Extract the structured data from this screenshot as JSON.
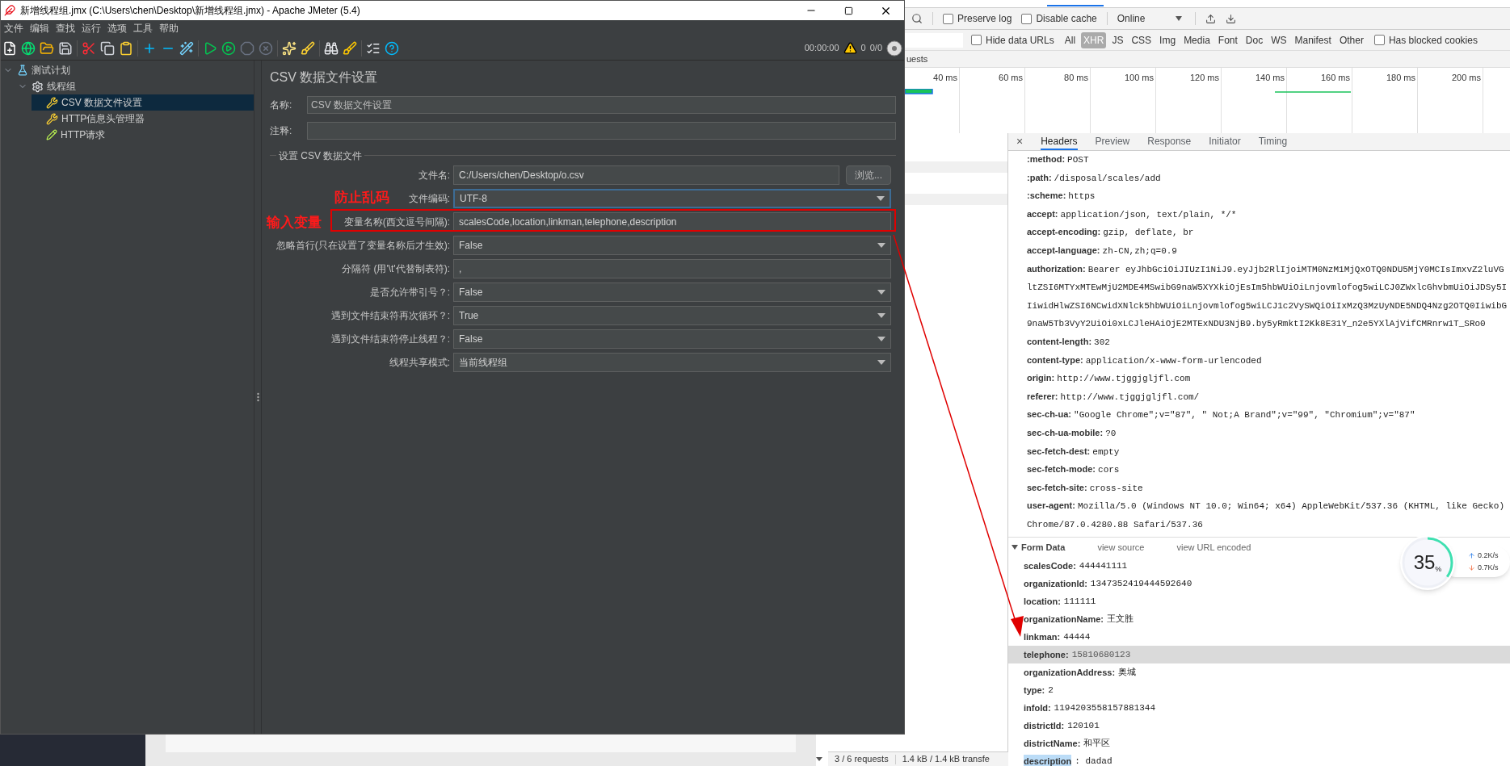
{
  "jmeter": {
    "window_title": "新增线程组.jmx (C:\\Users\\chen\\Desktop\\新增线程组.jmx) - Apache JMeter (5.4)",
    "menu": [
      "文件",
      "编辑",
      "查找",
      "运行",
      "选项",
      "工具",
      "帮助"
    ],
    "toolbar_status": {
      "timer": "00:00:00",
      "warnings": "0",
      "threads": "0/0"
    },
    "tree": [
      {
        "label": "测试计划",
        "kind": "plan",
        "selected": false,
        "expanded": true,
        "children": [
          {
            "label": "线程组",
            "kind": "group",
            "selected": false,
            "expanded": true,
            "children": [
              {
                "label": "CSV 数据文件设置",
                "kind": "config",
                "selected": true
              },
              {
                "label": "HTTP信息头管理器",
                "kind": "config",
                "selected": false
              },
              {
                "label": "HTTP请求",
                "kind": "sampler",
                "selected": false
              }
            ]
          }
        ]
      }
    ],
    "panel": {
      "title": "CSV 数据文件设置",
      "name_label": "名称:",
      "name_value": "CSV 数据文件设置",
      "comment_label": "注释:",
      "fieldset": "设置 CSV 数据文件",
      "rows": [
        {
          "kind": "file",
          "label": "文件名:",
          "value": "C:/Users/chen/Desktop/o.csv",
          "button": "浏览..."
        },
        {
          "kind": "select",
          "label": "文件编码:",
          "value": "UTF-8",
          "focused": true
        },
        {
          "kind": "text",
          "label": "变量名称(西文逗号间隔):",
          "value": "scalesCode,location,linkman,telephone,description"
        },
        {
          "kind": "select",
          "label": "忽略首行(只在设置了变量名称后才生效):",
          "value": "False",
          "focused": false
        },
        {
          "kind": "text",
          "label": "分隔符 (用'\\t'代替制表符):",
          "value": ","
        },
        {
          "kind": "select",
          "label": "是否允许带引号？:",
          "value": "False",
          "focused": false
        },
        {
          "kind": "select",
          "label": "遇到文件结束符再次循环？:",
          "value": "True",
          "focused": false
        },
        {
          "kind": "select",
          "label": "遇到文件结束符停止线程？:",
          "value": "False",
          "focused": false
        },
        {
          "kind": "select",
          "label": "线程共享模式:",
          "value": "当前线程组",
          "focused": false
        }
      ]
    }
  },
  "annotations": [
    {
      "kind": "note",
      "text": "防止乱码"
    },
    {
      "kind": "note",
      "text": "输入变量"
    },
    {
      "kind": "box"
    },
    {
      "kind": "arrow"
    }
  ],
  "devtools": {
    "toolbar": {
      "preserve_log": {
        "label": "Preserve log",
        "checked": false
      },
      "disable_cache": {
        "label": "Disable cache",
        "checked": false
      },
      "throttle": "Online"
    },
    "filters": {
      "hide_data_urls": {
        "label": "Hide data URLs",
        "checked": false
      },
      "types": [
        {
          "label": "All",
          "selected": false
        },
        {
          "label": "XHR",
          "selected": true
        },
        {
          "label": "JS",
          "selected": false
        },
        {
          "label": "CSS",
          "selected": false
        },
        {
          "label": "Img",
          "selected": false
        },
        {
          "label": "Media",
          "selected": false
        },
        {
          "label": "Font",
          "selected": false
        },
        {
          "label": "Doc",
          "selected": false
        },
        {
          "label": "WS",
          "selected": false
        },
        {
          "label": "Manifest",
          "selected": false
        },
        {
          "label": "Other",
          "selected": false
        }
      ],
      "blocked_cookies": {
        "label": "Has blocked cookies",
        "checked": false
      }
    },
    "requests_label": "uests",
    "timeline_ticks": [
      "40 ms",
      "60 ms",
      "80 ms",
      "100 ms",
      "120 ms",
      "140 ms",
      "160 ms",
      "180 ms",
      "200 ms"
    ],
    "detail_tabs": [
      {
        "label": "Headers",
        "selected": true
      },
      {
        "label": "Preview",
        "selected": false
      },
      {
        "label": "Response",
        "selected": false
      },
      {
        "label": "Initiator",
        "selected": false
      },
      {
        "label": "Timing",
        "selected": false
      }
    ],
    "close_glyph": "×",
    "headers": [
      {
        "name": ":method:",
        "value": "POST"
      },
      {
        "name": ":path:",
        "value": "/disposal/scales/add"
      },
      {
        "name": ":scheme:",
        "value": "https"
      },
      {
        "name": "accept:",
        "value": "application/json, text/plain, */*"
      },
      {
        "name": "accept-encoding:",
        "value": "gzip, deflate, br"
      },
      {
        "name": "accept-language:",
        "value": "zh-CN,zh;q=0.9"
      },
      {
        "name": "authorization:",
        "value": "Bearer eyJhbGciOiJIUzI1NiJ9.eyJjb2RlIjoiMTM0NzM1MjQxOTQ0NDU5MjY0MCIsImxvZ2luVGltZSI6MTYxMTEwMjU2MDE4MSwibG9naW5XYXkiOjEsIm5hbWUiOiLnjovmlofog5wiLCJ0ZWxlcGhvbmUiOiJDSy5IIiwidHlwZSI6NCwidXNlck5hbWUiOiLnjovmlofog5wiLCJ1c2VySWQiOiIxMzQ3MzUyNDE5NDQ4Nzg2OTQ0IiwibG9naW5Tb3VyY2UiOi0xLCJleHAiOjE2MTExNDU3NjB9.by5yRmktI2Kk8E31Y_n2e5YXlAjVifCMRnrw1T_SRo0"
      },
      {
        "name": "content-length:",
        "value": "302"
      },
      {
        "name": "content-type:",
        "value": "application/x-www-form-urlencoded"
      },
      {
        "name": "origin:",
        "value": "http://www.tjggjgljfl.com"
      },
      {
        "name": "referer:",
        "value": "http://www.tjggjgljfl.com/"
      },
      {
        "name": "sec-ch-ua:",
        "value": "\"Google Chrome\";v=\"87\", \" Not;A Brand\";v=\"99\", \"Chromium\";v=\"87\""
      },
      {
        "name": "sec-ch-ua-mobile:",
        "value": "?0"
      },
      {
        "name": "sec-fetch-dest:",
        "value": "empty"
      },
      {
        "name": "sec-fetch-mode:",
        "value": "cors"
      },
      {
        "name": "sec-fetch-site:",
        "value": "cross-site"
      },
      {
        "name": "user-agent:",
        "value": "Mozilla/5.0 (Windows NT 10.0; Win64; x64) AppleWebKit/537.36 (KHTML, like Gecko) Chrome/87.0.4280.88 Safari/537.36"
      }
    ],
    "form_data": {
      "title": "Form Data",
      "expanded": true,
      "links": [
        "view source",
        "view URL encoded"
      ],
      "fields": [
        {
          "name": "scalesCode:",
          "value": "444441111",
          "selected": false,
          "name_highlighted": false
        },
        {
          "name": "organizationId:",
          "value": "1347352419444592640",
          "selected": false,
          "name_highlighted": false
        },
        {
          "name": "location:",
          "value": "111111",
          "selected": false,
          "name_highlighted": false
        },
        {
          "name": "organizationName:",
          "value": "王文胜",
          "selected": false,
          "name_highlighted": false
        },
        {
          "name": "linkman:",
          "value": "44444",
          "selected": false,
          "name_highlighted": false
        },
        {
          "name": "telephone:",
          "value": "15810680123",
          "selected": true,
          "name_highlighted": false
        },
        {
          "name": "organizationAddress:",
          "value": "奥城",
          "selected": false,
          "name_highlighted": false
        },
        {
          "name": "type:",
          "value": "2",
          "selected": false,
          "name_highlighted": false
        },
        {
          "name": "infoId:",
          "value": "1194203558157881344",
          "selected": false,
          "name_highlighted": false
        },
        {
          "name": "districtId:",
          "value": "120101",
          "selected": false,
          "name_highlighted": false
        },
        {
          "name": "districtName:",
          "value": "和平区",
          "selected": false,
          "name_highlighted": false
        },
        {
          "name": "description",
          "value": ": dadad",
          "selected": false,
          "name_highlighted": true
        }
      ]
    },
    "status": [
      "3 / 6 requests",
      "1.4 kB / 1.4 kB transfe"
    ]
  },
  "speed_widget": {
    "percent": "35",
    "unit": "%",
    "level": 0.35,
    "upload": "0.2K/s",
    "download": "0.7K/s"
  }
}
